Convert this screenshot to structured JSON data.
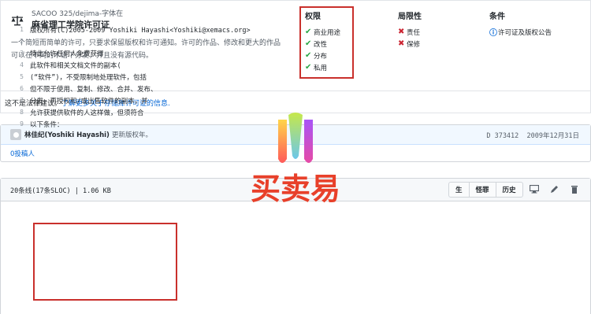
{
  "license": {
    "path": "SACOO 325/dejima-字体在",
    "title": "麻省理工学院许可证",
    "description": "一个简短而简单的许可，只要求保留版权和许可通知。许可的作品、修改和更大的作品可以在不同的术语下分发，并且没有源代码。"
  },
  "permissions": {
    "heading": "权限",
    "items": [
      "商业用途",
      "改性",
      "分布",
      "私用"
    ]
  },
  "limitations": {
    "heading": "局限性",
    "items": [
      "责任",
      "保修"
    ]
  },
  "conditions": {
    "heading": "条件",
    "items": [
      "许可证及版权公告"
    ]
  },
  "disclaimer": {
    "text": "这不是法律建议。",
    "link": "了解更多关于存储库许可证的信息."
  },
  "commit": {
    "author": "林佳纪(Yoshiki Hayashi)",
    "message": "更新版权年。",
    "hash": "D 373412",
    "date": "2009年12月31日",
    "contributors": "0投稿人"
  },
  "file": {
    "info": "20条线(17条SLOC) | 1.06 KB",
    "buttons": [
      "生",
      "怪罪",
      "历史"
    ],
    "lines": [
      {
        "n": "1",
        "t": "版权所有(C)2005-2009 Yoshiki Hayashi<Yoshiki@xemacs.org>"
      },
      {
        "n": "2",
        "t": ""
      },
      {
        "n": "3",
        "t": "特此允许任何人免费获得"
      },
      {
        "n": "4",
        "t": "此软件和相关文档文件的副本("
      },
      {
        "n": "5",
        "t": "(“软件”)，不受限制地处理软件，包括"
      },
      {
        "n": "6",
        "t": "但不限于使用、复制、修改、合并、发布、"
      },
      {
        "n": "7",
        "t": "分发、再授权和/或出售软件的副本，并"
      },
      {
        "n": "8",
        "t": "允许获提供软件的人这样做，但须符合"
      },
      {
        "n": "9",
        "t": "以下条件："
      }
    ]
  },
  "watermark": {
    "text": "买卖易"
  },
  "colors": {
    "success": "#28a745",
    "danger": "#cb2431",
    "link": "#0366d6",
    "highlight_border": "#c9302c"
  }
}
